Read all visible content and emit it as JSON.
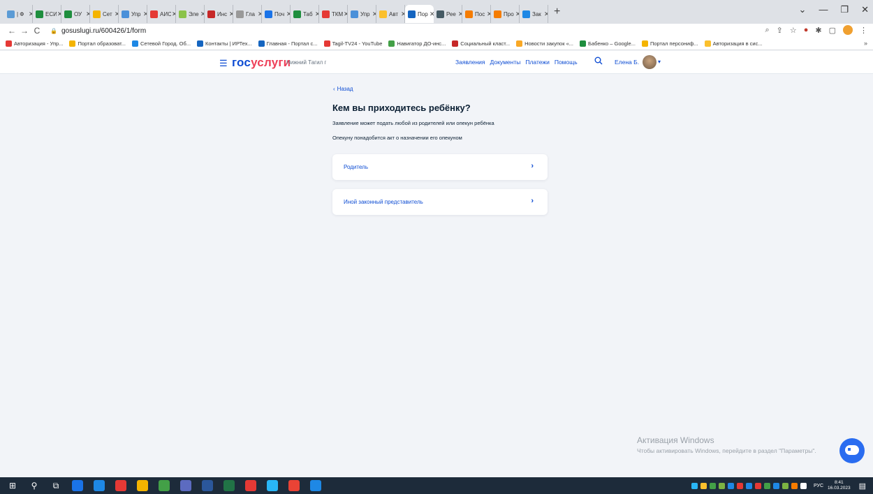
{
  "browser": {
    "tabs": [
      {
        "label": "| Ф",
        "color": "#5b9bd5"
      },
      {
        "label": "ЕСИ",
        "color": "#1e8e3e"
      },
      {
        "label": "ОУ",
        "color": "#1e8e3e"
      },
      {
        "label": "Сет",
        "color": "#f4b400"
      },
      {
        "label": "Упр",
        "color": "#4a90d9"
      },
      {
        "label": "АИС",
        "color": "#e53935"
      },
      {
        "label": "Эле",
        "color": "#8bc34a"
      },
      {
        "label": "Инс",
        "color": "#c62828"
      },
      {
        "label": "Гла",
        "color": "#999999"
      },
      {
        "label": "Поч",
        "color": "#1a73e8"
      },
      {
        "label": "Таб",
        "color": "#1e8e3e"
      },
      {
        "label": "ТКМ",
        "color": "#e53935"
      },
      {
        "label": "Упр",
        "color": "#4a90d9"
      },
      {
        "label": "Авт",
        "color": "#fbc02d"
      },
      {
        "label": "Пор",
        "color": "#1565c0",
        "active": true
      },
      {
        "label": "Рее",
        "color": "#455a64"
      },
      {
        "label": "Пос",
        "color": "#f57c00"
      },
      {
        "label": "Про",
        "color": "#f57c00"
      },
      {
        "label": "Зак",
        "color": "#1e88e5"
      }
    ],
    "new_tab": "+",
    "window_controls": [
      "⌄",
      "—",
      "❐",
      "✕"
    ],
    "url": "gosuslugi.ru/600426/1/form",
    "bookmarks": [
      {
        "label": "Авторизация - Упр...",
        "color": "#e53935"
      },
      {
        "label": "Портал образоват...",
        "color": "#f4b400"
      },
      {
        "label": "Сетевой Город. Об...",
        "color": "#1e88e5"
      },
      {
        "label": "Контакты | ИРТех...",
        "color": "#1565c0"
      },
      {
        "label": "Главная - Портал с...",
        "color": "#1565c0"
      },
      {
        "label": "Tagil-TV24 - YouTube",
        "color": "#e53935"
      },
      {
        "label": "Навигатор ДО-инс...",
        "color": "#43a047"
      },
      {
        "label": "Социальный класт...",
        "color": "#c62828"
      },
      {
        "label": "Новости закупок «...",
        "color": "#f9a825"
      },
      {
        "label": "Бабенко – Google...",
        "color": "#1e8e3e"
      },
      {
        "label": "Портал персониф...",
        "color": "#f4b400"
      },
      {
        "label": "Авторизация в сис...",
        "color": "#fbc02d"
      }
    ],
    "bookmarks_more": "»"
  },
  "header": {
    "logo_gos": "гос",
    "logo_uslugi": "услуги",
    "city": "Нижний Тагил г",
    "nav": [
      "Заявления",
      "Документы",
      "Платежи",
      "Помощь"
    ],
    "user_name": "Елена Б."
  },
  "main": {
    "back_label": "Назад",
    "title": "Кем вы приходитесь ребёнку?",
    "desc1": "Заявление может подать любой из родителей или опекун ребёнка",
    "desc2": "Опекуну понадобится акт о назначении его опекуном",
    "options": [
      {
        "label": "Родитель"
      },
      {
        "label": "Иной законный представитель"
      }
    ]
  },
  "windows_activation": {
    "title": "Активация Windows",
    "text": "Чтобы активировать Windows, перейдите в раздел \"Параметры\"."
  },
  "taskbar": {
    "apps": [
      "#1a73e8",
      "#1e88e5",
      "#e53935",
      "#f4b400",
      "#43a047",
      "#5c6bc0",
      "#2b579a",
      "#217346",
      "#e53935",
      "#29b6f6",
      "#ea4335",
      "#1e88e5"
    ],
    "tray_colors": [
      "#29b6f6",
      "#fbc02d",
      "#43a047",
      "#7cb342",
      "#1e88e5",
      "#e53935",
      "#1e88e5",
      "#e53935",
      "#43a047",
      "#1e88e5",
      "#7cb342",
      "#f57c00",
      "#ffffff"
    ],
    "lang": "РУС",
    "time": "8:41",
    "date": "16.03.2023"
  }
}
